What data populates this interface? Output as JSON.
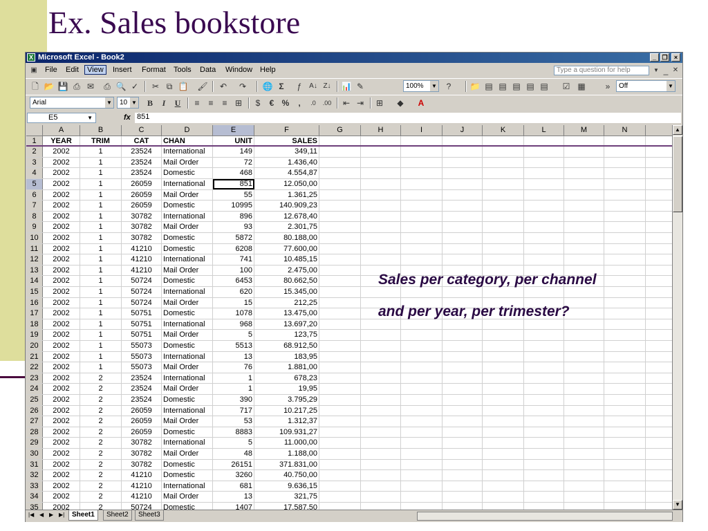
{
  "slide": {
    "title": "Ex. Sales bookstore",
    "question_line1": "Sales  per category, per channel",
    "question_line2": "and per year, per trimester?"
  },
  "window": {
    "title": "Microsoft Excel - Book2",
    "minimize": "_",
    "restore": "❐",
    "close": "×"
  },
  "menu": {
    "items": [
      "File",
      "Edit",
      "View",
      "Insert",
      "Format",
      "Tools",
      "Data",
      "Window",
      "Help"
    ],
    "active": "View",
    "ask_placeholder": "Type a question for help"
  },
  "toolbar": {
    "zoom": "100%",
    "off_combo": "Off",
    "font_name": "Arial",
    "font_size": "10",
    "sigma": "Σ",
    "euro": "€",
    "percent": "%",
    "comma": ","
  },
  "formula_bar": {
    "name_box": "E5",
    "fx": "fx",
    "value": "851"
  },
  "columns": [
    "A",
    "B",
    "C",
    "D",
    "E",
    "F",
    "G",
    "H",
    "I",
    "J",
    "K",
    "L",
    "M",
    "N"
  ],
  "selected_column": "E",
  "selected_row": 5,
  "header_row": [
    "YEAR",
    "TRIM",
    "CAT",
    "CHAN",
    "UNIT",
    "SALES"
  ],
  "rows": [
    [
      "2002",
      "1",
      "23524",
      "International",
      "149",
      "349,11"
    ],
    [
      "2002",
      "1",
      "23524",
      "Mail Order",
      "72",
      "1.436,40"
    ],
    [
      "2002",
      "1",
      "23524",
      "Domestic",
      "468",
      "4.554,87"
    ],
    [
      "2002",
      "1",
      "26059",
      "International",
      "851",
      "12.050,00"
    ],
    [
      "2002",
      "1",
      "26059",
      "Mail Order",
      "55",
      "1.361,25"
    ],
    [
      "2002",
      "1",
      "26059",
      "Domestic",
      "10995",
      "140.909,23"
    ],
    [
      "2002",
      "1",
      "30782",
      "International",
      "896",
      "12.678,40"
    ],
    [
      "2002",
      "1",
      "30782",
      "Mail Order",
      "93",
      "2.301,75"
    ],
    [
      "2002",
      "1",
      "30782",
      "Domestic",
      "5872",
      "80.188,00"
    ],
    [
      "2002",
      "1",
      "41210",
      "Domestic",
      "6208",
      "77.600,00"
    ],
    [
      "2002",
      "1",
      "41210",
      "International",
      "741",
      "10.485,15"
    ],
    [
      "2002",
      "1",
      "41210",
      "Mail Order",
      "100",
      "2.475,00"
    ],
    [
      "2002",
      "1",
      "50724",
      "Domestic",
      "6453",
      "80.662,50"
    ],
    [
      "2002",
      "1",
      "50724",
      "International",
      "620",
      "15.345,00"
    ],
    [
      "2002",
      "1",
      "50724",
      "Mail Order",
      "15",
      "212,25"
    ],
    [
      "2002",
      "1",
      "50751",
      "Domestic",
      "1078",
      "13.475,00"
    ],
    [
      "2002",
      "1",
      "50751",
      "International",
      "968",
      "13.697,20"
    ],
    [
      "2002",
      "1",
      "50751",
      "Mail Order",
      "5",
      "123,75"
    ],
    [
      "2002",
      "1",
      "55073",
      "Domestic",
      "5513",
      "68.912,50"
    ],
    [
      "2002",
      "1",
      "55073",
      "International",
      "13",
      "183,95"
    ],
    [
      "2002",
      "1",
      "55073",
      "Mail Order",
      "76",
      "1.881,00"
    ],
    [
      "2002",
      "2",
      "23524",
      "International",
      "1",
      "678,23"
    ],
    [
      "2002",
      "2",
      "23524",
      "Mail Order",
      "1",
      "19,95"
    ],
    [
      "2002",
      "2",
      "23524",
      "Domestic",
      "390",
      "3.795,29"
    ],
    [
      "2002",
      "2",
      "26059",
      "International",
      "717",
      "10.217,25"
    ],
    [
      "2002",
      "2",
      "26059",
      "Mail Order",
      "53",
      "1.312,37"
    ],
    [
      "2002",
      "2",
      "26059",
      "Domestic",
      "8883",
      "109.931,27"
    ],
    [
      "2002",
      "2",
      "30782",
      "International",
      "5",
      "11.000,00"
    ],
    [
      "2002",
      "2",
      "30782",
      "Mail Order",
      "48",
      "1.188,00"
    ],
    [
      "2002",
      "2",
      "30782",
      "Domestic",
      "26151",
      "371.831,00"
    ],
    [
      "2002",
      "2",
      "41210",
      "Domestic",
      "3260",
      "40.750,00"
    ],
    [
      "2002",
      "2",
      "41210",
      "International",
      "681",
      "9.636,15"
    ],
    [
      "2002",
      "2",
      "41210",
      "Mail Order",
      "13",
      "321,75"
    ],
    [
      "2002",
      "2",
      "50724",
      "Domestic",
      "1407",
      "17.587,50"
    ]
  ],
  "sheets": [
    "Sheet1",
    "Sheet2",
    "Sheet3"
  ],
  "active_sheet": "Sheet1",
  "colors": {
    "accent_bar": "#dede9c",
    "title": "#3a0a50",
    "selection": "#b6bdd2"
  }
}
